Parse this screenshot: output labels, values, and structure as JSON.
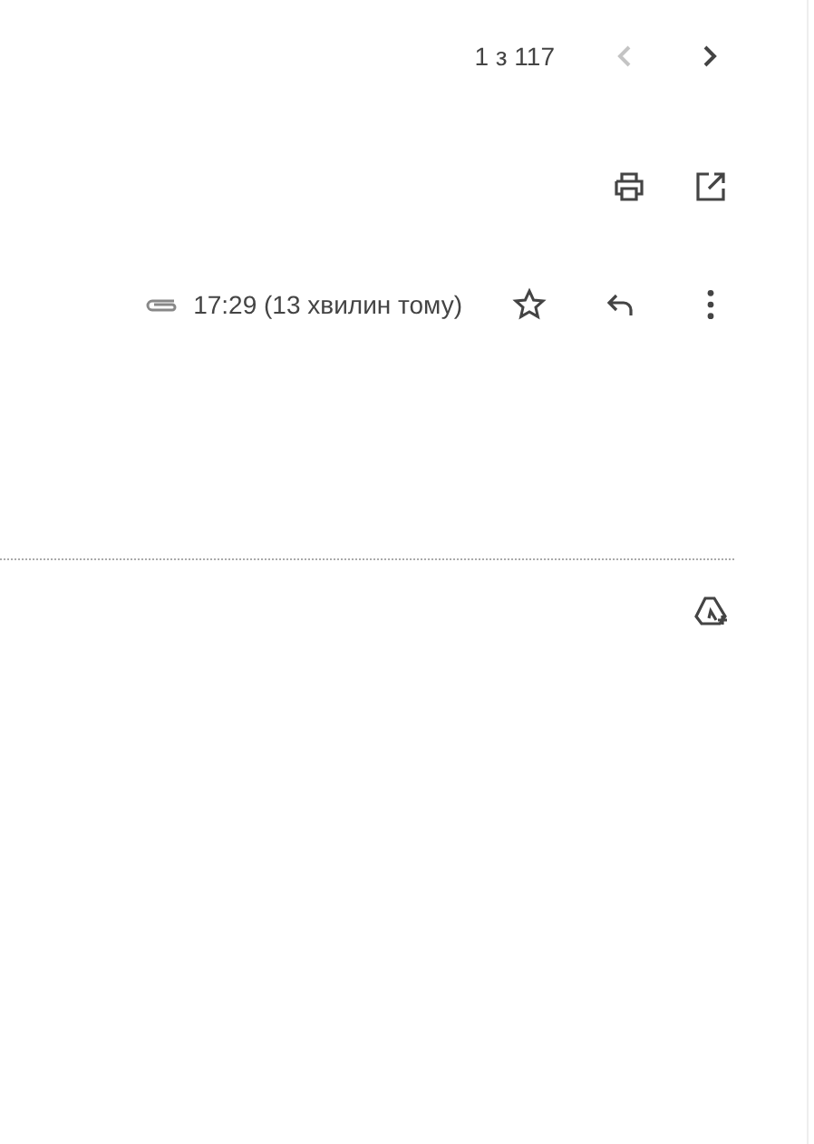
{
  "pager": {
    "text": "1 з 117",
    "prev": {
      "disabled": true
    },
    "next": {
      "disabled": false
    }
  },
  "message": {
    "has_attachment": true,
    "time": "17:29 (13 хвилин тому)",
    "starred": false
  }
}
